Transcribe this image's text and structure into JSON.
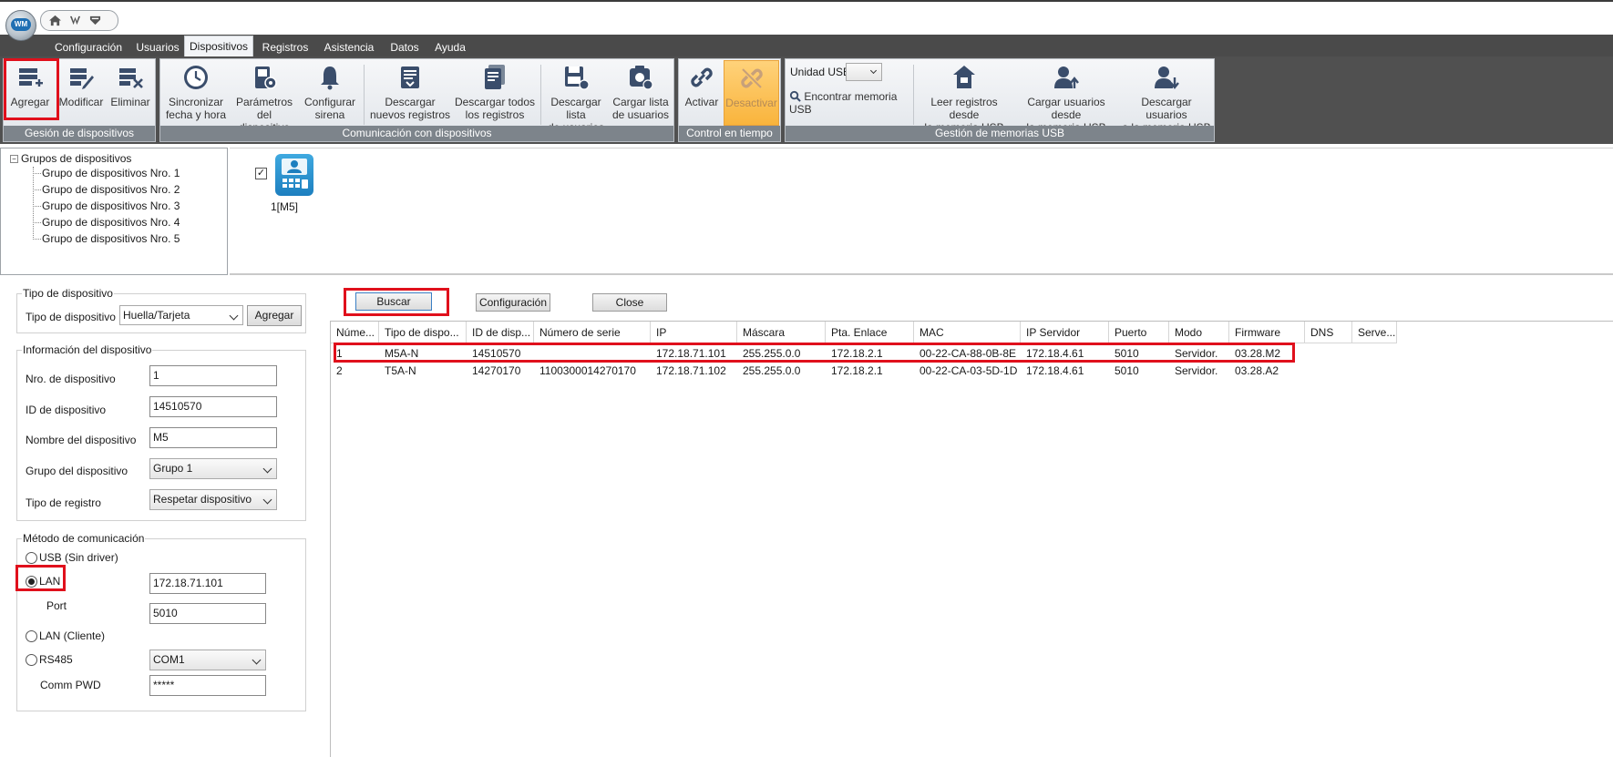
{
  "app": {
    "logo_text": "WM",
    "quick_icons": [
      "home-icon",
      "user-edit-icon",
      "shield-icon"
    ]
  },
  "menu": {
    "tabs": [
      {
        "label": "Configuración"
      },
      {
        "label": "Usuarios"
      },
      {
        "label": "Dispositivos",
        "active": true
      },
      {
        "label": "Registros"
      },
      {
        "label": "Asistencia"
      },
      {
        "label": "Datos"
      },
      {
        "label": "Ayuda"
      }
    ]
  },
  "ribbon": {
    "groups": [
      {
        "label": "Gesión de dispositivos"
      },
      {
        "label": "Comunicación con dispositivos"
      },
      {
        "label": "Control en tiempo real"
      },
      {
        "label": "Gestión de memorias USB"
      }
    ],
    "buttons": {
      "agregar": [
        "Agregar"
      ],
      "modificar": [
        "Modificar"
      ],
      "eliminar": [
        "Eliminar"
      ],
      "sincronizar": [
        "Sincronizar",
        "fecha y hora"
      ],
      "parametros": [
        "Parámetros",
        "del dispositivo"
      ],
      "configurar": [
        "Configurar",
        "sirena"
      ],
      "descargar_nuevos": [
        "Descargar",
        "nuevos registros"
      ],
      "descargar_todos": [
        "Descargar todos",
        "los registros"
      ],
      "descargar_lista": [
        "Descargar lista",
        "de usuarios"
      ],
      "cargar_lista": [
        "Cargar lista",
        "de usuarios"
      ],
      "activar": [
        "Activar"
      ],
      "desactivar": [
        "Desactivar"
      ],
      "leer_usb": [
        "Leer registros desde",
        "la memoria USB"
      ],
      "cargar_usb": [
        "Cargar usuarios desde",
        "la memoria USB"
      ],
      "descargar_usb": [
        "Descargar usuarios",
        "a la memoria USB"
      ]
    },
    "usb": {
      "unit_label": "Unidad USB",
      "unit_value": "",
      "find_label": "Encontrar memoria USB"
    }
  },
  "tree": {
    "root": "Grupos de dispositivos",
    "items": [
      "Grupo de dispositivos Nro. 1",
      "Grupo de dispositivos Nro. 2",
      "Grupo de dispositivos Nro. 3",
      "Grupo de dispositivos Nro. 4",
      "Grupo de dispositivos Nro. 5"
    ]
  },
  "device_icon": {
    "label": "1[M5]",
    "checked_mark": "✓"
  },
  "left": {
    "tipo": {
      "legend": "Tipo de dispositivo",
      "label": "Tipo de dispositivo",
      "value": "Huella/Tarjeta",
      "add_button": "Agregar"
    },
    "info": {
      "legend": "Información del dispositivo",
      "nro_label": "Nro. de dispositivo",
      "nro_value": "1",
      "id_label": "ID de dispositivo",
      "id_value": "14510570",
      "nombre_label": "Nombre del dispositivo",
      "nombre_value": "M5",
      "grupo_label": "Grupo del dispositivo",
      "grupo_value": "Grupo 1",
      "registro_label": "Tipo de registro",
      "registro_value": "Respetar dispositivo"
    },
    "comm": {
      "legend": "Método de comunicación",
      "usb_label": "USB (Sin driver)",
      "lan_label": "LAN",
      "lan_ip": "172.18.71.101",
      "port_label": "Port",
      "port_value": "5010",
      "lan_client_label": "LAN (Cliente)",
      "rs485_label": "RS485",
      "rs485_value": "COM1",
      "pwd_label": "Comm PWD",
      "pwd_value": "*****"
    }
  },
  "actions": {
    "buscar": "Buscar",
    "configuracion": "Configuración",
    "close": "Close"
  },
  "table": {
    "headers": [
      "Núme...",
      "Tipo de dispo...",
      "ID de disp...",
      "Número de serie",
      "IP",
      "Máscara",
      "Pta. Enlace",
      "MAC",
      "IP Servidor",
      "Puerto",
      "Modo",
      "Firmware",
      "DNS",
      "Serve..."
    ],
    "rows": [
      [
        "1",
        "M5A-N",
        "14510570",
        "",
        "172.18.71.101",
        "255.255.0.0",
        "172.18.2.1",
        "00-22-CA-88-0B-8E",
        "172.18.4.61",
        "5010",
        "Servidor.",
        "03.28.M2",
        "",
        ""
      ],
      [
        "2",
        "T5A-N",
        "14270170",
        "1100300014270170",
        "172.18.71.102",
        "255.255.0.0",
        "172.18.2.1",
        "00-22-CA-03-5D-1D",
        "172.18.4.61",
        "5010",
        "Servidor.",
        "03.28.A2",
        "",
        ""
      ]
    ]
  },
  "colors": {
    "highlight_red": "#e0101c",
    "ribbon_bg": "#505050",
    "accent_blue": "#1d7fbf",
    "active_orange": "#f9b43c"
  }
}
